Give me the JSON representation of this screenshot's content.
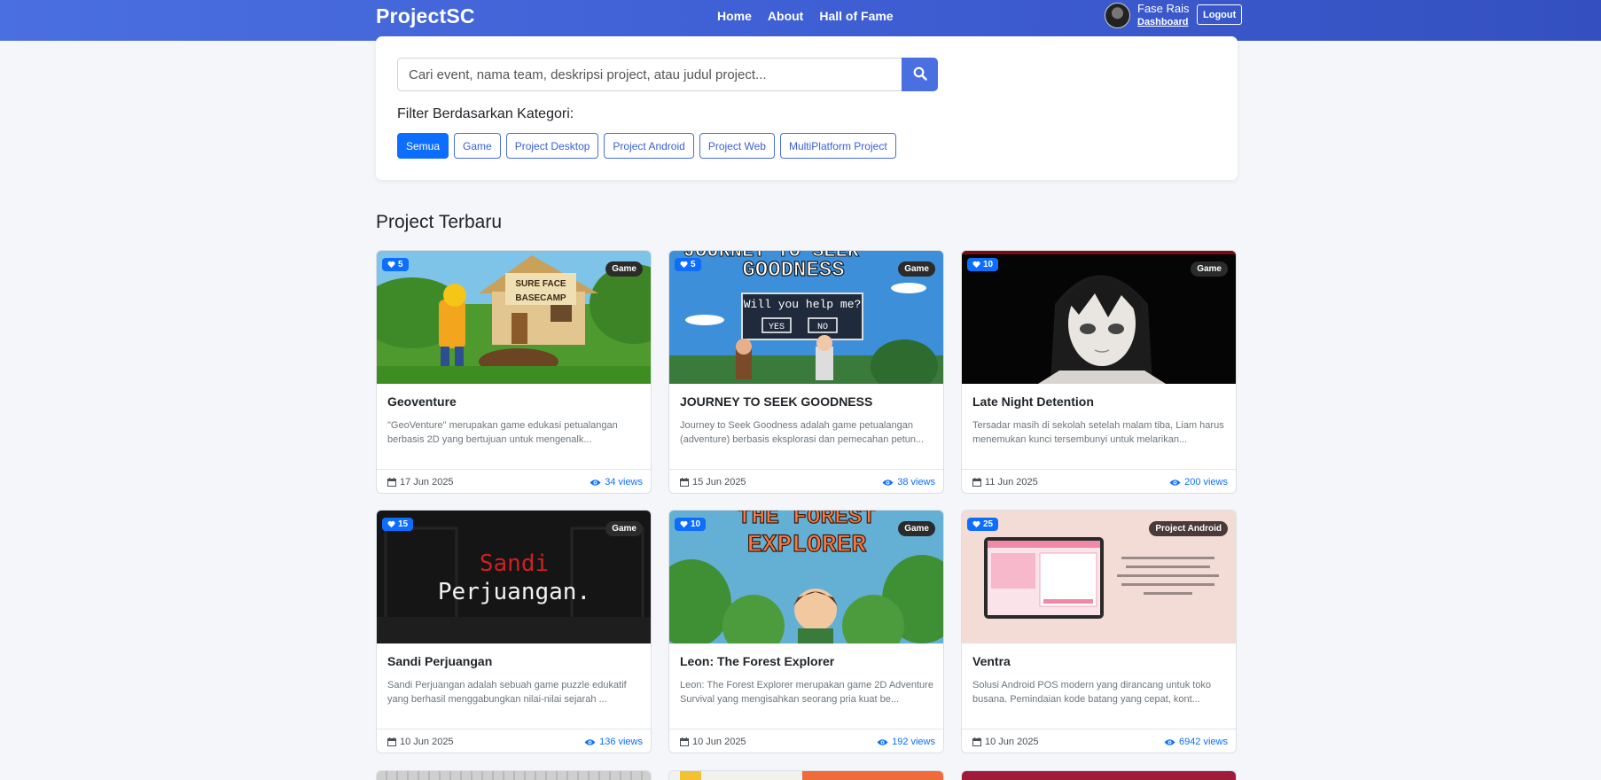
{
  "nav": {
    "brand": "ProjectSC",
    "links": [
      "Home",
      "About",
      "Hall of Fame"
    ],
    "user_name": "Fase Rais",
    "dashboard": "Dashboard",
    "logout": "Logout"
  },
  "search": {
    "placeholder": "Cari event, nama team, deskripsi project, atau judul project...",
    "icon": "search-icon",
    "filter_label": "Filter Berdasarkan Kategori:",
    "filters": [
      "Semua",
      "Game",
      "Project Desktop",
      "Project Android",
      "Project Web",
      "MultiPlatform Project"
    ],
    "active_filter": "Semua"
  },
  "section_title": "Project Terbaru",
  "cards": [
    {
      "likes": "5",
      "category": "Game",
      "title": "Geoventure",
      "desc": "\"GeoVenture\" merupakan game edukasi petualangan berbasis 2D yang bertujuan untuk mengenalk...",
      "date": "17 Jun 2025",
      "views": "34 views",
      "thumb_text": [
        "SURE FACE",
        "BASECAMP"
      ]
    },
    {
      "likes": "5",
      "category": "Game",
      "title": "JOURNEY TO SEEK GOODNESS",
      "desc": "Journey to Seek Goodness adalah game petualangan (adventure) berbasis eksplorasi dan pemecahan petun...",
      "date": "15 Jun 2025",
      "views": "38 views",
      "thumb_text": [
        "JOURNEY TO SEEK",
        "GOODNESS",
        "Will you help me?",
        "YES",
        "NO"
      ]
    },
    {
      "likes": "10",
      "category": "Game",
      "title": "Late Night Detention",
      "desc": "Tersadar masih di sekolah setelah malam tiba, Liam harus menemukan kunci tersembunyi untuk melarikan...",
      "date": "11 Jun 2025",
      "views": "200 views",
      "thumb_text": []
    },
    {
      "likes": "15",
      "category": "Game",
      "title": "Sandi Perjuangan",
      "desc": "Sandi Perjuangan adalah sebuah game puzzle edukatif yang berhasil menggabungkan nilai-nilai sejarah ...",
      "date": "10 Jun 2025",
      "views": "136 views",
      "thumb_text": [
        "Sandi",
        "Perjuangan."
      ]
    },
    {
      "likes": "10",
      "category": "Game",
      "title": "Leon: The Forest Explorer",
      "desc": "Leon: The Forest Explorer merupakan game 2D Adventure Survival yang mengisahkan seorang pria kuat be...",
      "date": "10 Jun 2025",
      "views": "192 views",
      "thumb_text": [
        "THE FOREST",
        "EXPLORER"
      ]
    },
    {
      "likes": "25",
      "category": "Project Android",
      "title": "Ventra",
      "desc": "Solusi Android POS modern yang dirancang untuk toko busana. Pemindaian kode batang yang cepat, kont...",
      "date": "10 Jun 2025",
      "views": "6942 views",
      "thumb_text": []
    }
  ]
}
